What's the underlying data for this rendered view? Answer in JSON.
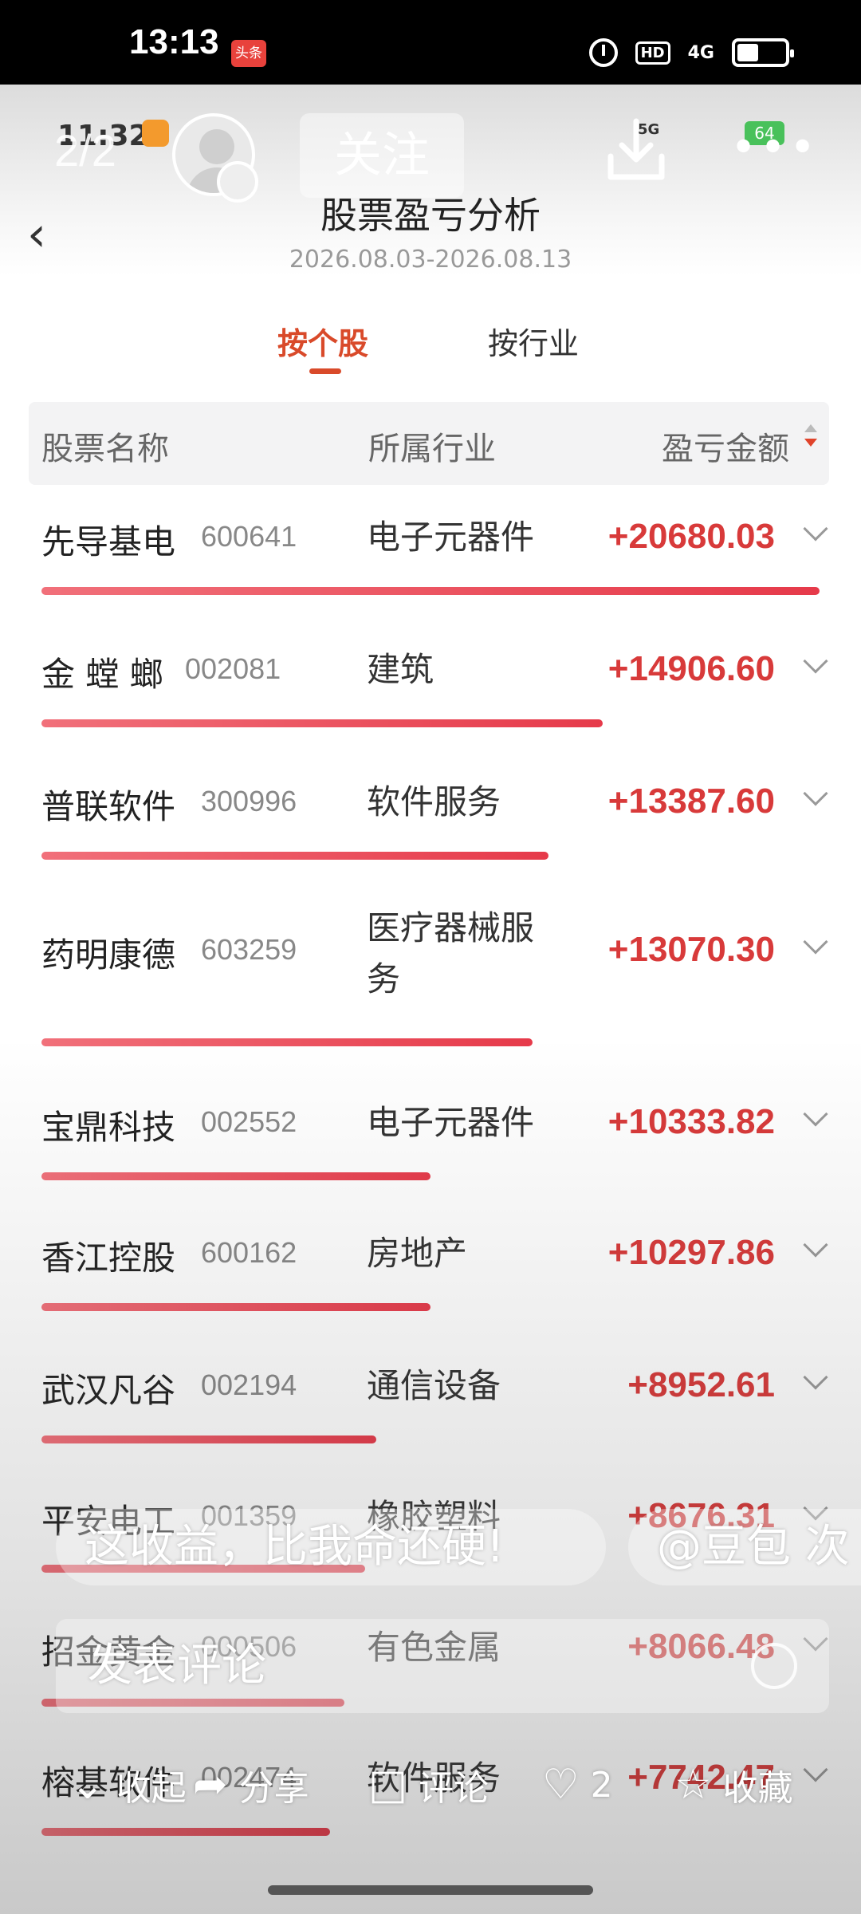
{
  "status_bar": {
    "time": "13:13",
    "app_badge": "头条",
    "network": "4G",
    "hd": "HD"
  },
  "viewer": {
    "page_counter": "2/2",
    "follow_label": "关注",
    "inner_time": "11:32",
    "inner_battery": "64",
    "inner_signal": "5G"
  },
  "page": {
    "title": "股票盈亏分析",
    "date_range": "2026.08.03-2026.08.13"
  },
  "tabs": [
    {
      "label": "按个股",
      "active": true
    },
    {
      "label": "按行业",
      "active": false
    }
  ],
  "table": {
    "headers": {
      "name": "股票名称",
      "industry": "所属行业",
      "amount": "盈亏金额"
    },
    "rows": [
      {
        "name": "先导基电",
        "code": "600641",
        "industry": "电子元器件",
        "amount": "+20680.03"
      },
      {
        "name": "金 螳 螂",
        "code": "002081",
        "industry": "建筑",
        "amount": "+14906.60"
      },
      {
        "name": "普联软件",
        "code": "300996",
        "industry": "软件服务",
        "amount": "+13387.60"
      },
      {
        "name": "药明康德",
        "code": "603259",
        "industry": "医疗器械服务",
        "amount": "+13070.30"
      },
      {
        "name": "宝鼎科技",
        "code": "002552",
        "industry": "电子元器件",
        "amount": "+10333.82"
      },
      {
        "name": "香江控股",
        "code": "600162",
        "industry": "房地产",
        "amount": "+10297.86"
      },
      {
        "name": "武汉凡谷",
        "code": "002194",
        "industry": "通信设备",
        "amount": "+8952.61"
      },
      {
        "name": "平安电工",
        "code": "001359",
        "industry": "橡胶塑料",
        "amount": "+8676.31"
      },
      {
        "name": "招金黄金",
        "code": "000506",
        "industry": "有色金属",
        "amount": "+8066.48"
      },
      {
        "name": "榕基软件",
        "code": "002474",
        "industry": "软件服务",
        "amount": "+7742.47"
      }
    ]
  },
  "overlay": {
    "danmaku": [
      "这收益，比我命还硬!",
      "@豆包 次"
    ],
    "comment_placeholder": "发表评论",
    "actions": {
      "collapse": "收起",
      "share": "分享",
      "comment": "评论",
      "like_count": "2",
      "favorite": "收藏"
    }
  },
  "colors": {
    "accent": "#d94a2a",
    "profit": "#d83a3a",
    "bar": "#e63a4a"
  }
}
